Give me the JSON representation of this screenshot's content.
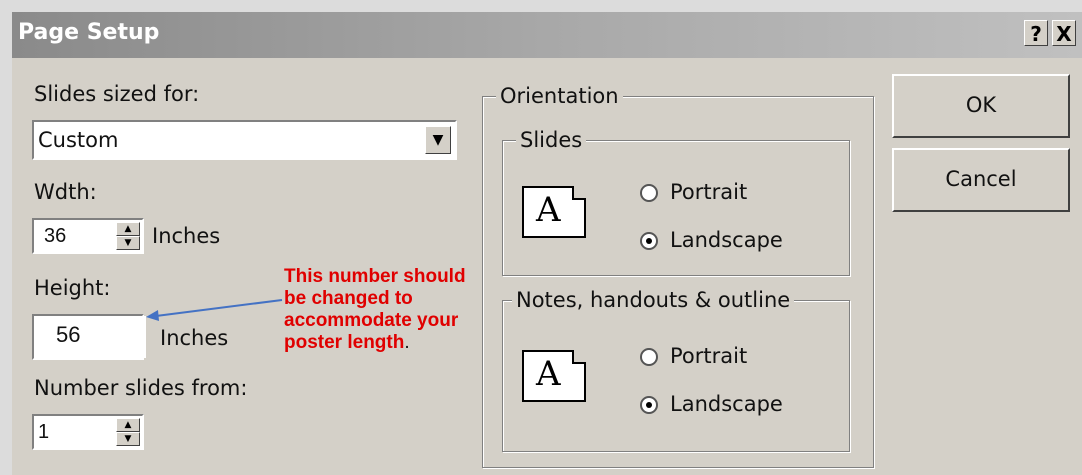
{
  "window": {
    "title": "Page Setup",
    "help_label": "?",
    "close_label": "X"
  },
  "slides_sized_for": {
    "label": "Slides sized for:",
    "value": "Custom"
  },
  "width": {
    "label": "Wdth:",
    "value": "36",
    "unit": "Inches"
  },
  "height": {
    "label": "Height:",
    "value": "56",
    "unit": "Inches"
  },
  "number_slides_from": {
    "label": "Number slides from:",
    "value": "1"
  },
  "orientation": {
    "group_label": "Orientation",
    "slides": {
      "label": "Slides",
      "icon_letter": "A",
      "options": [
        "Portrait",
        "Landscape"
      ],
      "selected": "Landscape"
    },
    "notes": {
      "label": "Notes, handouts & outline",
      "icon_letter": "A",
      "options": [
        "Portrait",
        "Landscape"
      ],
      "selected": "Landscape"
    }
  },
  "buttons": {
    "ok": "OK",
    "cancel": "Cancel"
  },
  "annotation": {
    "text": "This number should be changed to accommodate your poster length",
    "tail": ".",
    "color": "#e00000",
    "arrow_color": "#4472c4"
  }
}
